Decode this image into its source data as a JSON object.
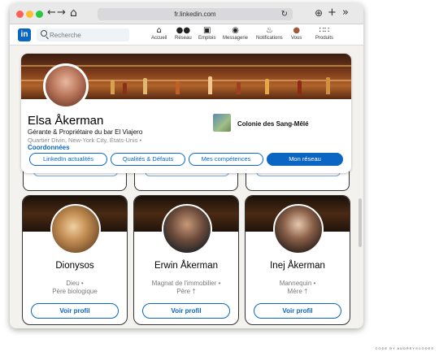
{
  "browser": {
    "url": "fr.linkedin.com",
    "back_glyph": "←",
    "forward_glyph": "→",
    "home_glyph": "⌂",
    "reload_glyph": "↻",
    "download_glyph": "⊕",
    "newtab_glyph": "+",
    "more_glyph": "»"
  },
  "linkedin_nav": {
    "logo": "in",
    "search_placeholder": "Recherche",
    "items": [
      {
        "label": "Accueil",
        "icon": "home-icon",
        "glyph": "⌂"
      },
      {
        "label": "Réseau",
        "icon": "network-icon",
        "glyph": "👥"
      },
      {
        "label": "Emplois",
        "icon": "briefcase-icon",
        "glyph": "💼"
      },
      {
        "label": "Messagerie",
        "icon": "message-icon",
        "glyph": "💬"
      },
      {
        "label": "Notifications",
        "icon": "bell-icon",
        "glyph": "🔔"
      },
      {
        "label": "Vous",
        "icon": "avatar-icon",
        "glyph": "●"
      },
      {
        "label": "Produits",
        "icon": "grid-icon",
        "glyph": "⋮⋮"
      }
    ]
  },
  "profile": {
    "name": "Elsa Åkerman",
    "headline": "Gérante & Propriétaire du bar El Viajero",
    "location": "Quartier Divin, New-York City, États-Unis •",
    "contact_label": "Coordonnées",
    "company": "Colonie des Sang-Mêlé",
    "tabs": [
      {
        "label": "LinkedIn actualités",
        "active": false
      },
      {
        "label": "Qualités & Défauts",
        "active": false
      },
      {
        "label": "Mes compétences",
        "active": false
      },
      {
        "label": "Mon réseau",
        "active": true
      }
    ]
  },
  "network": {
    "cards": [
      {
        "name": "Dionysos",
        "line1": "Dieu •",
        "line2": "Père biologique",
        "button": "Voir profil"
      },
      {
        "name": "Erwin Åkerman",
        "line1": "Magnat de l'immobilier •",
        "line2": "Père †",
        "button": "Voir profil"
      },
      {
        "name": "Inej Åkerman",
        "line1": "Mannequin •",
        "line2": "Mère †",
        "button": "Voir profil"
      }
    ]
  },
  "credit": "CODE BY AUDREYSCODES",
  "colors": {
    "brand_blue": "#0a66c2",
    "page_bg": "#f4f2ee"
  }
}
